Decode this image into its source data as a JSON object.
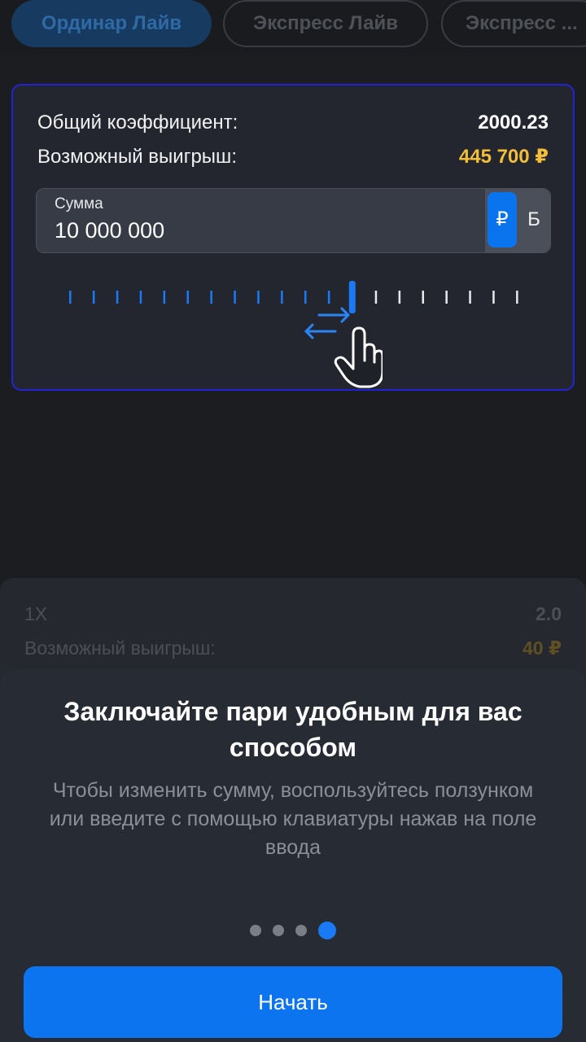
{
  "tabs": [
    {
      "label": "Ординар Лайв",
      "active": true
    },
    {
      "label": "Экспресс Лайв",
      "active": false
    },
    {
      "label": "Экспресс ...",
      "active": false
    }
  ],
  "bet_card": {
    "total_odds_label": "Общий коэффициент:",
    "total_odds_value": "2000.23",
    "win_label": "Возможный выигрыш:",
    "win_value": "445 700  ₽",
    "amount_label": "Сумма",
    "amount_value": "10 000 000",
    "currency_rub": "₽",
    "currency_b": "Б",
    "slider_ticks_total": 21,
    "slider_active_index": 13
  },
  "background_card": {
    "market_label": "1X",
    "market_odds": "2.0",
    "win_label": "Возможный выигрыш:",
    "win_value": "40  ₽"
  },
  "onboarding": {
    "title": "Заключайте пари удобным для вас способом",
    "description": "Чтобы изменить сумму, воспользуйтесь ползунком или введите с помощью клавиатуры нажав на поле ввода",
    "pages_total": 4,
    "current_page": 4,
    "start_button": "Начать"
  },
  "colors": {
    "accent": "#0b74ee",
    "gold": "#f3be3a",
    "highlight_border": "#2323d6"
  },
  "icons": [
    "swipe-hand-icon",
    "horizontal-arrows-icon"
  ]
}
